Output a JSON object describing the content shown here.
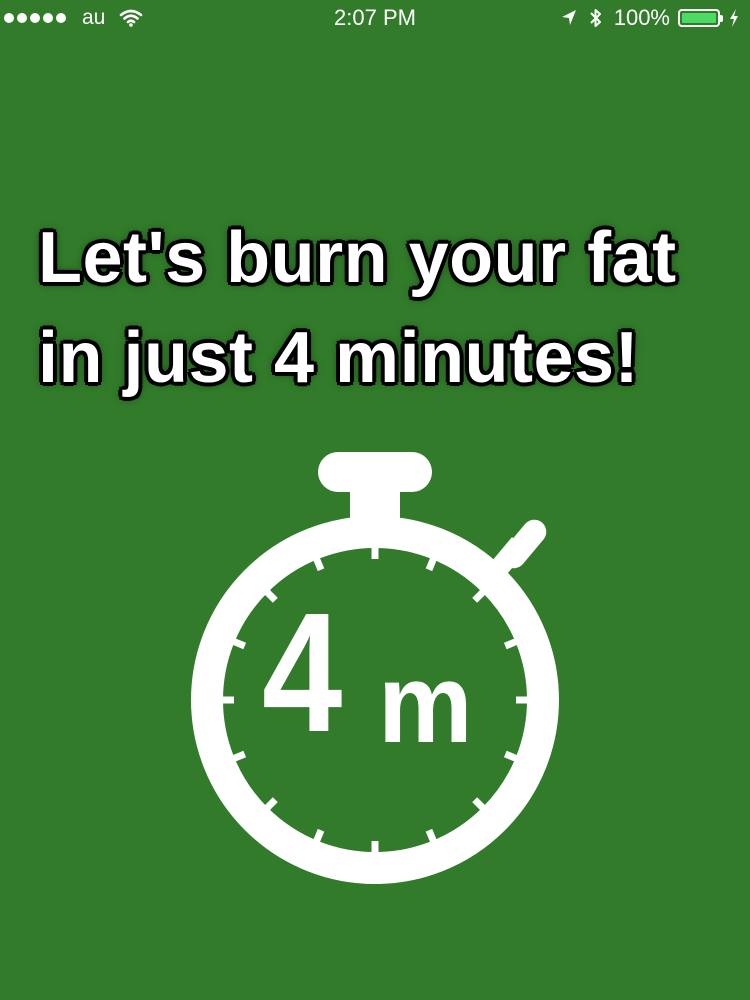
{
  "status_bar": {
    "signal_dots": 5,
    "carrier": "au",
    "time": "2:07 PM",
    "battery_percent": "100%",
    "battery_level": 1.0,
    "icons": [
      "signal-icon",
      "wifi-icon",
      "location-arrow-icon",
      "bluetooth-icon",
      "battery-icon",
      "charging-icon"
    ]
  },
  "headline": {
    "line1": "Let's burn your fat",
    "line2": "in just 4 minutes!"
  },
  "timer_icon": {
    "icon": "stopwatch-icon",
    "digit": "4",
    "unit": "m"
  },
  "colors": {
    "background": "#317b2a",
    "text": "#ffffff",
    "text_outline": "#000000",
    "battery_fill": "#4cd964"
  }
}
